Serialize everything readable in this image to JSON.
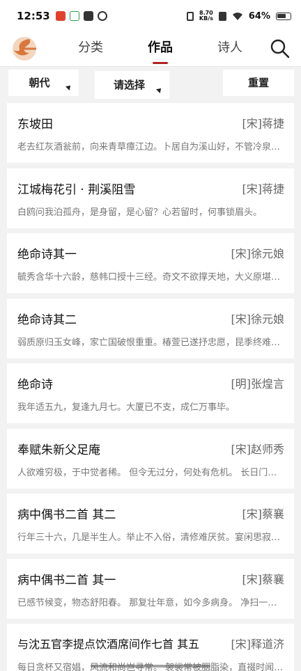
{
  "status_bar": {
    "time": "12:53",
    "net_speed_value": "8.70",
    "net_speed_unit": "KB/s",
    "battery": "64%"
  },
  "header": {
    "tabs": [
      {
        "label": "分类",
        "active": false
      },
      {
        "label": "作品",
        "active": true
      },
      {
        "label": "诗人",
        "active": false
      }
    ]
  },
  "filters": {
    "dynasty": "朝代",
    "select": "请选择",
    "reset": "重置"
  },
  "poems": [
    {
      "title": "东坡田",
      "author": "[宋]蒋捷",
      "excerpt": "老去红灰酒瓮前，向来青草瘴江边。卜居自为溪山好，不管冷泉与热泉。"
    },
    {
      "title": "江城梅花引 · 荆溪阻雪",
      "author": "[宋]蒋捷",
      "excerpt": "白鸥问我泊孤舟，是身留，是心留？心若留时，何事锁眉头。"
    },
    {
      "title": "绝命诗其一",
      "author": "[宋]徐元娘",
      "excerpt": "毓秀含华十六龄，慈帏口授十三经。奇文不欲撑天地，大义原堪照日星。"
    },
    {
      "title": "绝命诗其二",
      "author": "[宋]徐元娘",
      "excerpt": "弱质原归玉女峰，家亡国破恨重重。椿萱已遂抒忠愿，昆季终难守孝踪。"
    },
    {
      "title": "绝命诗",
      "author": "[明]张煌言",
      "excerpt": "我年适五九，复逢九月七。大厦已不支，成仁万事毕。"
    },
    {
      "title": "奉赋朱新父足庵",
      "author": "[宋]赵师秀",
      "excerpt": "人欲难穷极，于中觉者稀。 但令无过分，何处有危机。 长日门常掩。"
    },
    {
      "title": "病中偶书二首 其二",
      "author": "[宋]蔡襄",
      "excerpt": "行年三十六，几是半生人。举止不入俗，清修难厌贫。宴闲思寂寞。"
    },
    {
      "title": "病中偶书二首 其一",
      "author": "[宋]蔡襄",
      "excerpt": "已感节候变，物态舒阳春。 那复壮年意，如今多病身。 净扫一室内。"
    },
    {
      "title": "与沈五官李提点饮酒席间作七首 其五",
      "author": "[宋]释道济",
      "excerpt": "每日贪杯又宿娼，风流和尚岂寻常。 袈裟常被胭脂染，直裰时闻麝香。"
    }
  ]
}
